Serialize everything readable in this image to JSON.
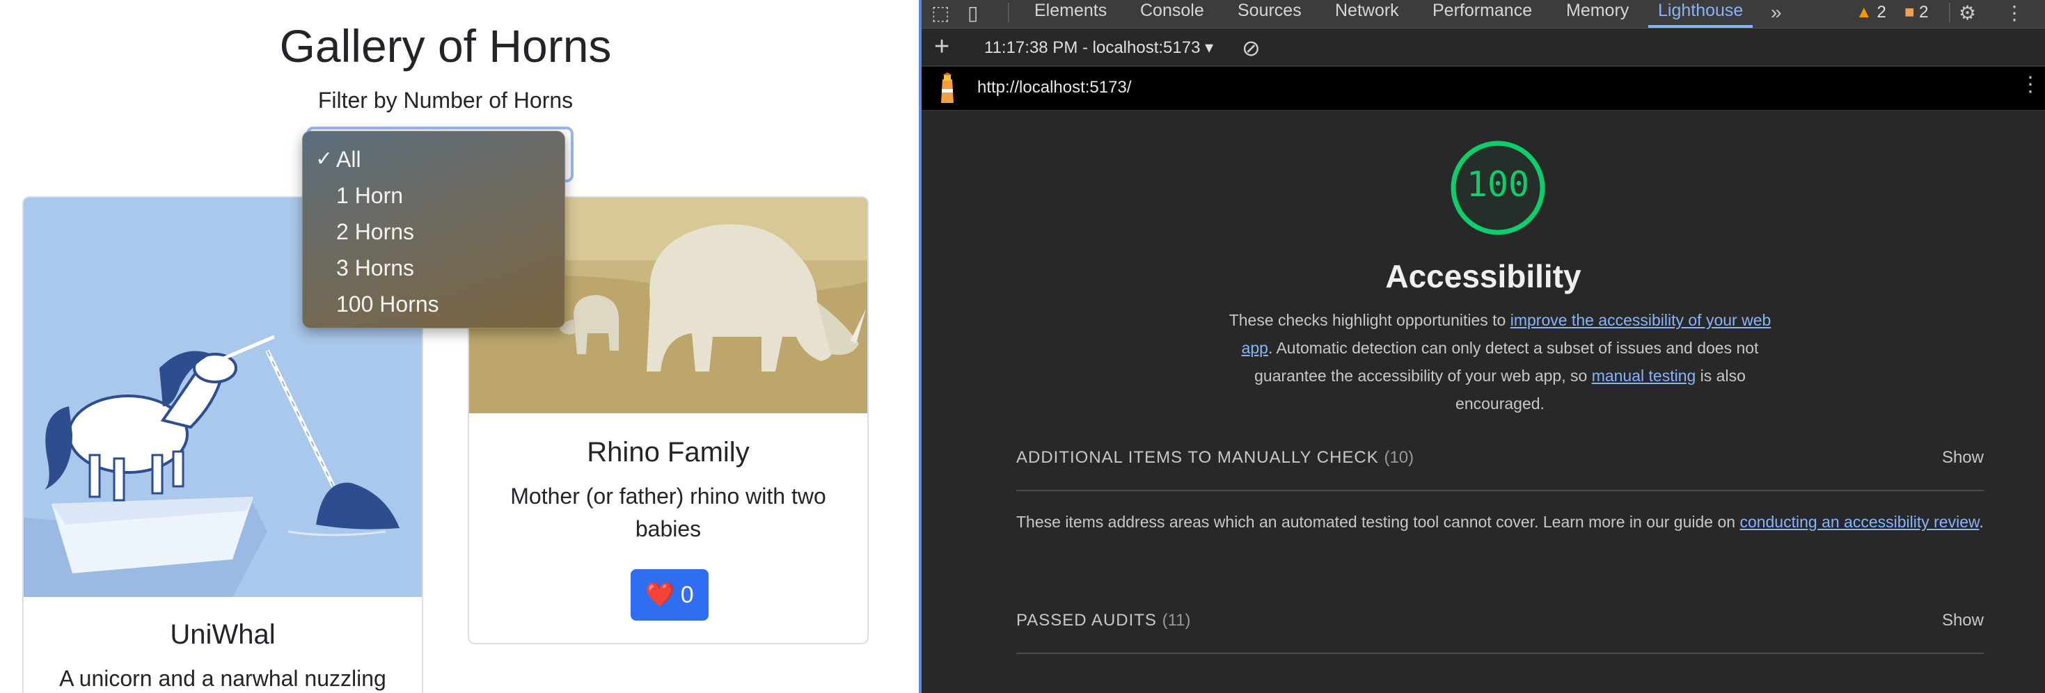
{
  "app": {
    "title": "Gallery of Horns",
    "filter_label": "Filter by Number of Horns",
    "dropdown_options": [
      {
        "label": "All",
        "selected": true
      },
      {
        "label": "1 Horn",
        "selected": false
      },
      {
        "label": "2 Horns",
        "selected": false
      },
      {
        "label": "3 Horns",
        "selected": false
      },
      {
        "label": "100 Horns",
        "selected": false
      }
    ],
    "check_glyph": "✓",
    "cards": [
      {
        "title": "UniWhal",
        "description": "A unicorn and a narwhal nuzzling"
      },
      {
        "title": "Rhino Family",
        "description": "Mother (or father) rhino with two babies",
        "like_icon": "❤️",
        "like_count": "0"
      }
    ]
  },
  "devtools": {
    "tabs": [
      "Elements",
      "Console",
      "Sources",
      "Network",
      "Performance",
      "Memory",
      "Lighthouse"
    ],
    "active_tab": "Lighthouse",
    "more_tabs_glyph": "»",
    "warnings_count": "2",
    "errors_count": "2",
    "toolbar": {
      "plus": "+",
      "report_selector": "11:17:38 PM - localhost:5173",
      "clear_glyph": "⊘"
    },
    "url": "http://localhost:5173/",
    "lighthouse": {
      "score": "100",
      "category": "Accessibility",
      "desc_part1": "These checks highlight opportunities to ",
      "desc_link1": "improve the accessibility of your web app",
      "desc_part2": ". Automatic detection can only detect a subset of issues and does not guarantee the accessibility of your web app, so ",
      "desc_link2": "manual testing",
      "desc_part3": " is also encouraged.",
      "manual_section": {
        "heading": "ADDITIONAL ITEMS TO MANUALLY CHECK",
        "count": "(10)",
        "show_label": "Show",
        "body_text": "These items address areas which an automated testing tool cannot cover. Learn more in our guide on ",
        "body_link": "conducting an accessibility review",
        "body_end": "."
      },
      "passed_section": {
        "heading": "PASSED AUDITS",
        "count": "(11)",
        "show_label": "Show"
      }
    },
    "colors": {
      "score_green": "#0cce6b",
      "link_blue": "#8ab4f8",
      "panel_bg": "#282828"
    }
  }
}
